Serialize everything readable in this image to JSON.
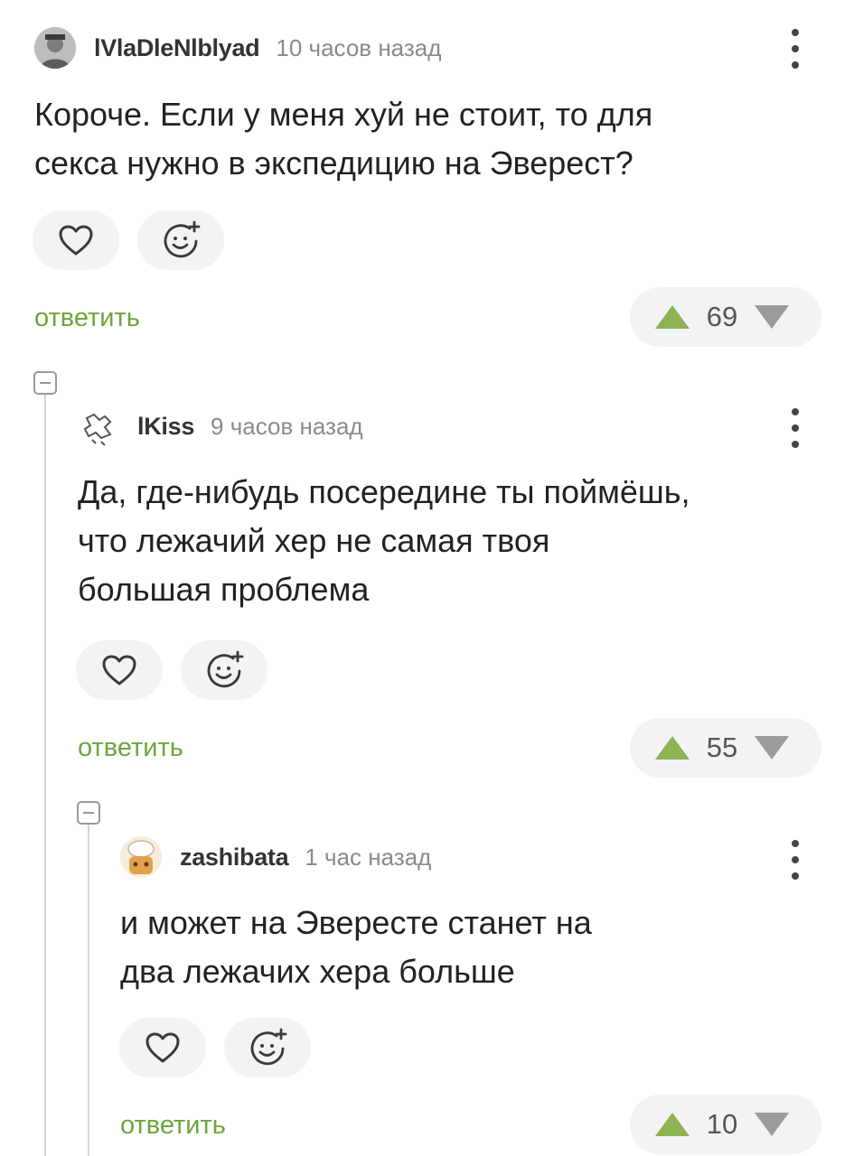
{
  "comments": [
    {
      "username": "lVlaDleNlblyad",
      "time": "10 часов назад",
      "lines": [
        "Короче. Если у меня хуй не стоит, то для",
        "секса нужно в экспедицию на Эверест?"
      ],
      "reply_label": "ответить",
      "rating": "69"
    },
    {
      "username": "lKiss",
      "time": "9 часов назад",
      "lines": [
        "Да, где-нибудь посередине ты поймёшь,",
        "что лежачий хер не самая твоя",
        "большая проблема"
      ],
      "reply_label": "ответить",
      "rating": "55"
    },
    {
      "username": "zashibata",
      "time": "1 час назад",
      "lines": [
        "и может на Эвересте станет на",
        "два лежачих хера больше"
      ],
      "reply_label": "ответить",
      "rating": "10"
    }
  ],
  "icons": {
    "like": "heart-icon",
    "reaction": "emoji-add-icon",
    "upvote": "upvote-arrow-icon",
    "downvote": "downvote-arrow-icon",
    "menu": "more-vertical-icon",
    "collapse": "collapse-minus-icon"
  },
  "colors": {
    "accent_green": "#6da63c",
    "vote_arrow": "#8fb253",
    "button_bg": "#f2f3f5"
  }
}
